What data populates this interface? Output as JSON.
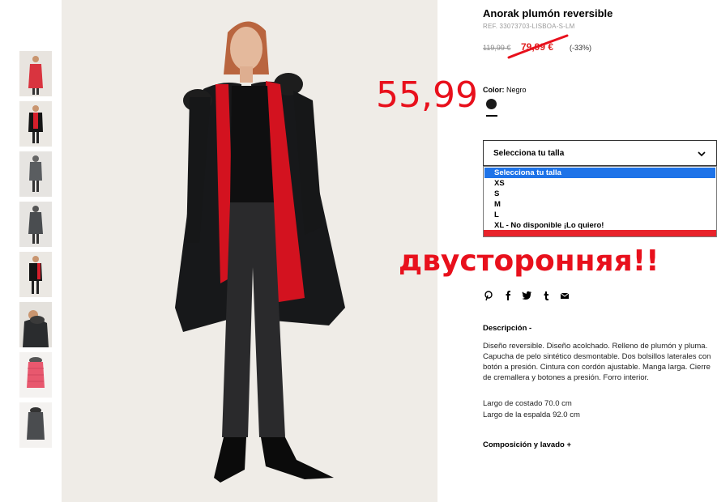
{
  "product": {
    "title": "Anorak plumón reversible",
    "ref": "REF. 33073703-LISBOA-S-LM",
    "price_old": "119,99 €",
    "price_new": "79,99 €",
    "discount": "(-33%)"
  },
  "annotations": {
    "handwritten_price": "55,99",
    "handwritten_word": "двусторонняя!!",
    "color": "#e8101c"
  },
  "color": {
    "label": "Color:",
    "value": "Negro",
    "swatch": "#1a1a1a"
  },
  "size_select": {
    "label": "Selecciona tu talla",
    "options": [
      "Selecciona tu talla",
      "XS",
      "S",
      "M",
      "L",
      "XL - No disponible ¡Lo quiero!"
    ],
    "highlight_color": "#1e73e8"
  },
  "share": {
    "icons": [
      "pinterest-icon",
      "facebook-icon",
      "twitter-icon",
      "tumblr-icon",
      "email-icon"
    ]
  },
  "description": {
    "title": "Descripción -",
    "body": "Diseño reversible. Diseño acolchado. Relleno de plumón y pluma. Capucha de pelo sintético desmontable. Dos bolsillos laterales con botón a presión. Cintura con cordón ajustable. Manga larga. Cierre de cremallera y botones a presión. Forro interior.",
    "measurements": [
      "Largo de costado 70.0 cm",
      "Largo de la espalda 92.0 cm"
    ]
  },
  "composition": {
    "title": "Composición y lavado +"
  },
  "thumbnails": [
    {
      "name": "thumb-red-coat",
      "variant": "red"
    },
    {
      "name": "thumb-model-front",
      "variant": "black-red"
    },
    {
      "name": "thumb-grey-coat",
      "variant": "grey"
    },
    {
      "name": "thumb-grey-side",
      "variant": "grey"
    },
    {
      "name": "thumb-model-side",
      "variant": "black-red"
    },
    {
      "name": "thumb-hood-detail",
      "variant": "black"
    },
    {
      "name": "thumb-pink-coat",
      "variant": "pink"
    },
    {
      "name": "thumb-dark-coat",
      "variant": "grey"
    }
  ]
}
